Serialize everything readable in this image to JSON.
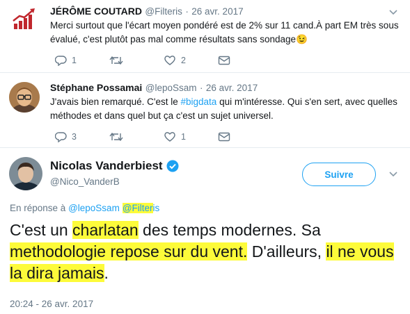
{
  "tweets": [
    {
      "author": "JÉRÔME COUTARD",
      "handle": "@Filteris",
      "sep": "·",
      "date": "26 avr. 2017",
      "text": "Merci surtout que l'écart moyen pondéré est de 2% sur 11 cand.À part EM très sous évalué, c'est plutôt pas mal comme résultats sans sondage",
      "emoji": "😉",
      "replies": "1",
      "retweets": "",
      "likes": "2"
    },
    {
      "author": "Stéphane Possamai",
      "handle": "@lepoSsam",
      "sep": "·",
      "date": "26 avr. 2017",
      "text_before": "J'avais bien remarqué. C'est le ",
      "hashtag": "#bigdata",
      "text_after": " qui m'intéresse. Qui s'en sert, avec quelles méthodes et dans quel but ça c'est un sujet universel.",
      "replies": "3",
      "retweets": "",
      "likes": "1"
    }
  ],
  "main_tweet": {
    "author": "Nicolas Vanderbiest",
    "verified": true,
    "handle": "@Nico_VanderB",
    "follow_label": "Suivre",
    "reply_prefix": "En réponse à",
    "mention1": "@lepoSsam",
    "mention2_a": "@Filter",
    "mention2_b": "is",
    "text": {
      "p1": "C'est un ",
      "h1": "charlatan",
      "p2": " des temps modernes. Sa ",
      "h2": "methodologie repose sur du vent.",
      "p3": " D'ailleurs, ",
      "h3": "il ne vous la dira jamais",
      "p4": "."
    },
    "timestamp": "20:24 - 26 avr. 2017"
  },
  "colors": {
    "accent": "#1da1f2",
    "highlight": "#fdfb3a",
    "muted": "#657786"
  }
}
